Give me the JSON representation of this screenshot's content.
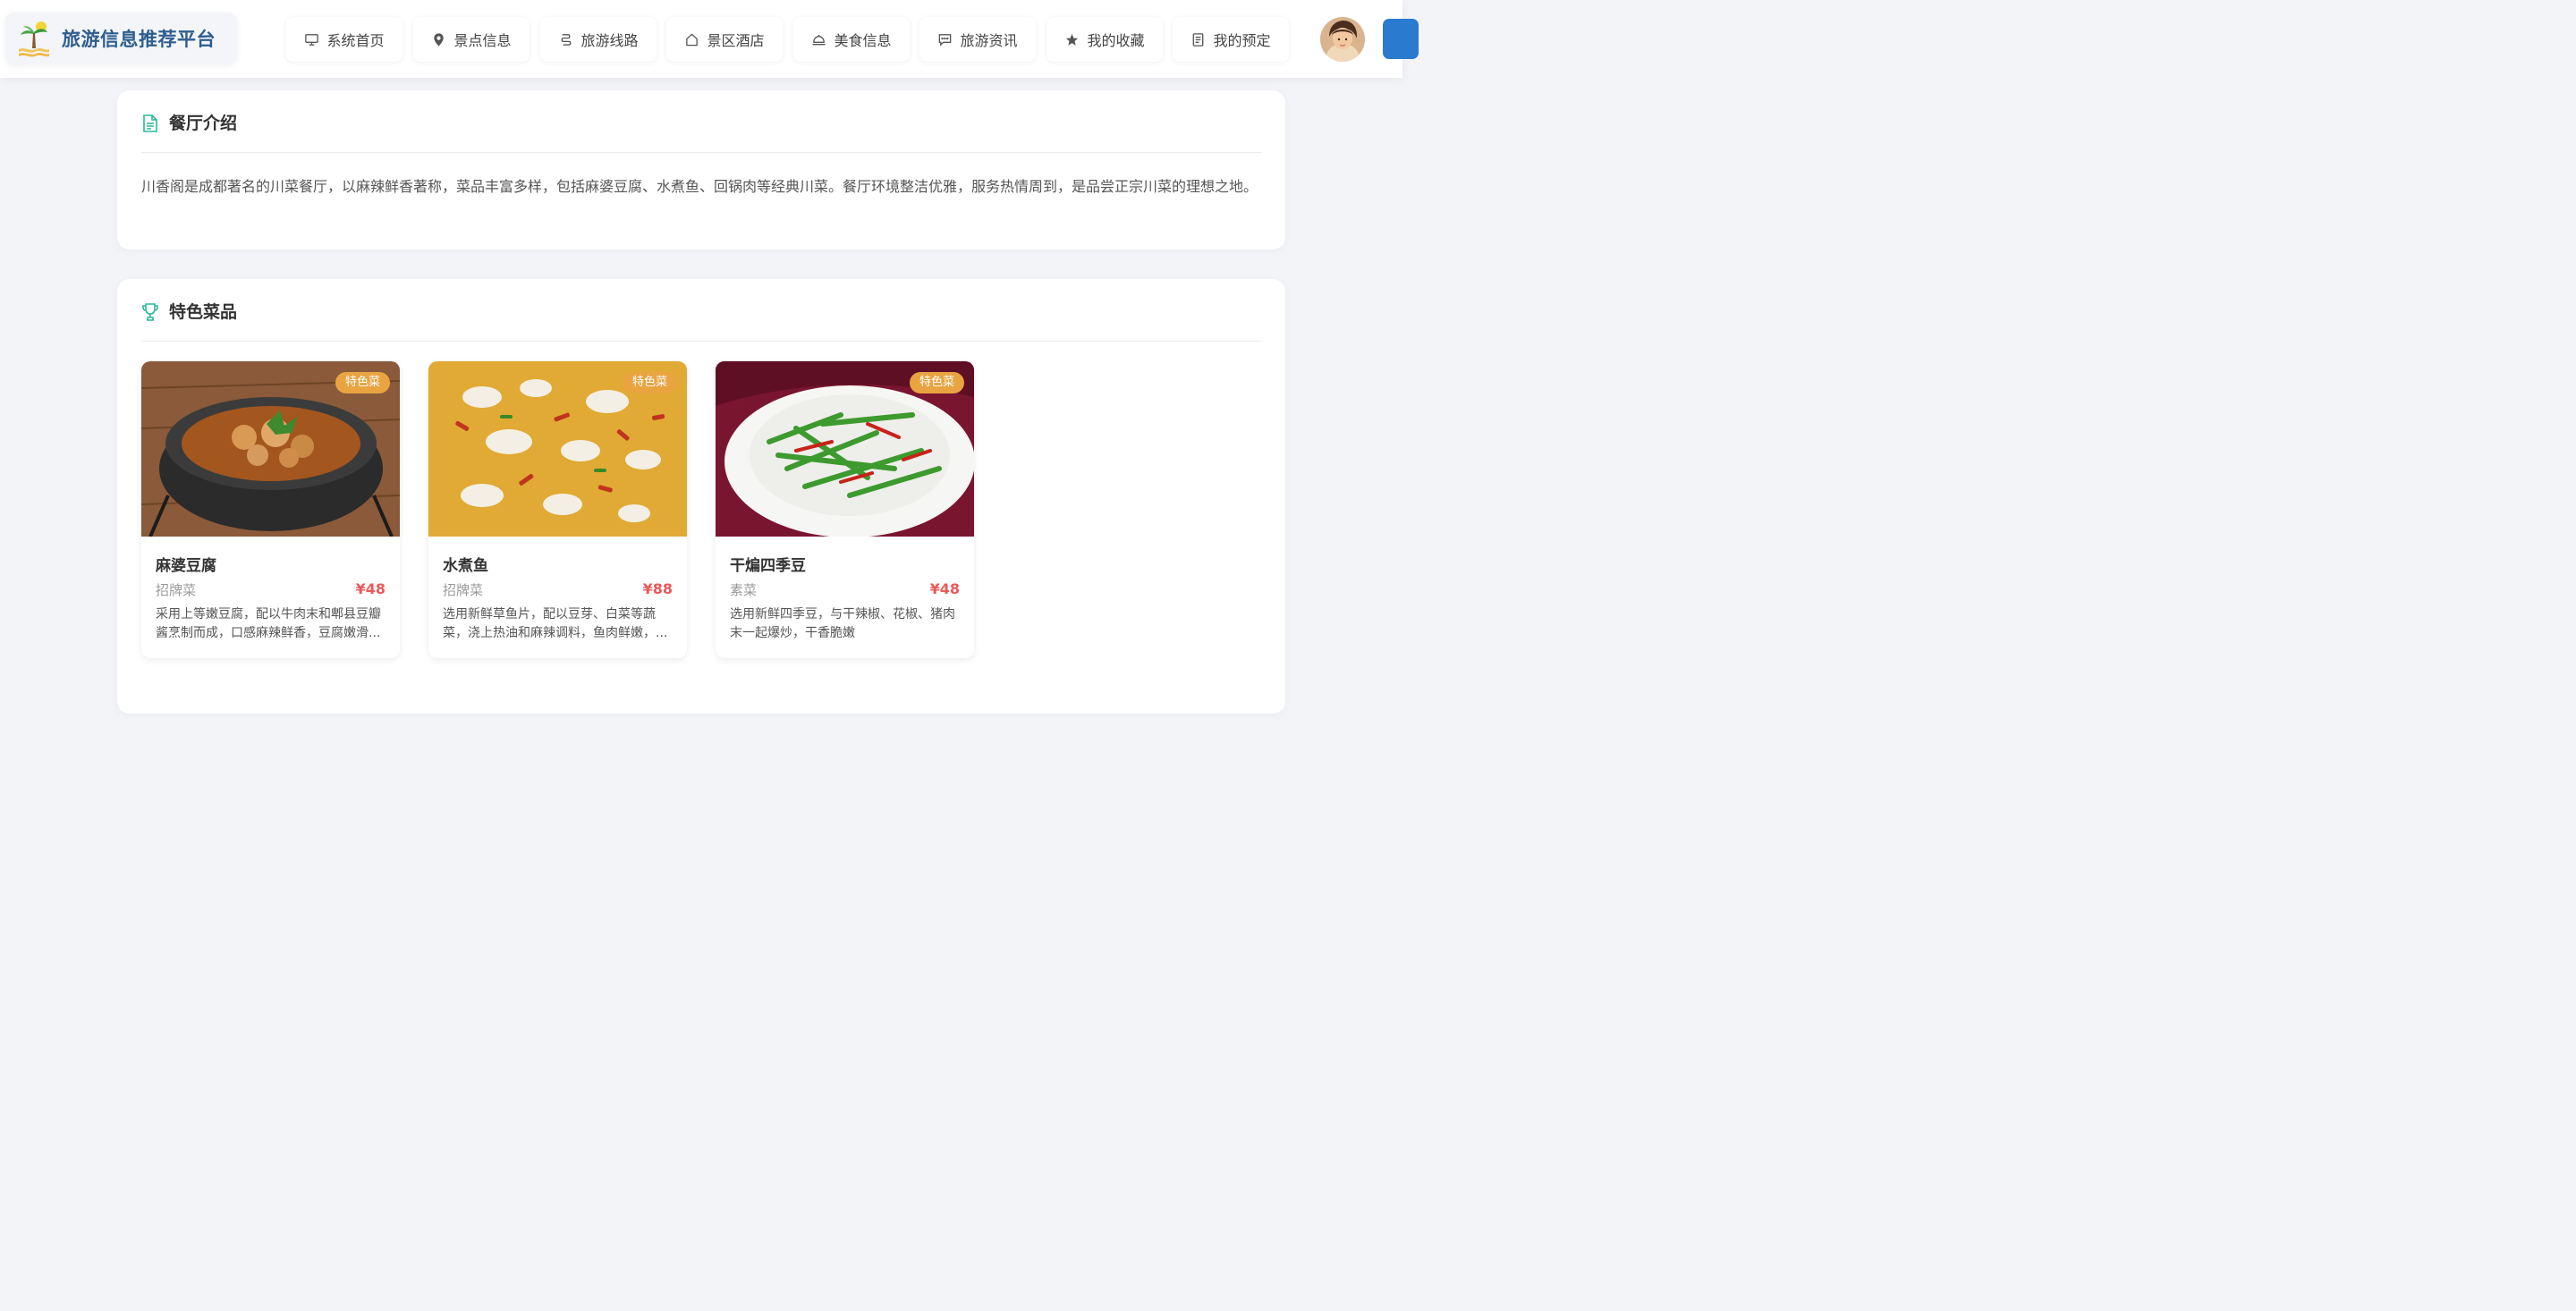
{
  "header": {
    "brand_title": "旅游信息推荐平台",
    "nav": [
      {
        "label": "系统首页",
        "icon": "monitor-icon"
      },
      {
        "label": "景点信息",
        "icon": "map-pin-icon"
      },
      {
        "label": "旅游线路",
        "icon": "route-icon"
      },
      {
        "label": "景区酒店",
        "icon": "home-icon"
      },
      {
        "label": "美食信息",
        "icon": "dish-cover-icon"
      },
      {
        "label": "旅游资讯",
        "icon": "chat-icon"
      },
      {
        "label": "我的收藏",
        "icon": "star-icon"
      },
      {
        "label": "我的预定",
        "icon": "document-icon"
      }
    ]
  },
  "intro": {
    "title": "餐厅介绍",
    "text": "川香阁是成都著名的川菜餐厅，以麻辣鲜香著称，菜品丰富多样，包括麻婆豆腐、水煮鱼、回锅肉等经典川菜。餐厅环境整洁优雅，服务热情周到，是品尝正宗川菜的理想之地。"
  },
  "featured": {
    "title": "特色菜品",
    "dishes": [
      {
        "badge": "特色菜",
        "name": "麻婆豆腐",
        "category": "招牌菜",
        "price": "¥48",
        "description": "采用上等嫩豆腐，配以牛肉末和郫县豆瓣酱烹制而成，口感麻辣鲜香，豆腐嫩滑..."
      },
      {
        "badge": "特色菜",
        "name": "水煮鱼",
        "category": "招牌菜",
        "price": "¥88",
        "description": "选用新鲜草鱼片，配以豆芽、白菜等蔬菜，浇上热油和麻辣调料，鱼肉鲜嫩，..."
      },
      {
        "badge": "特色菜",
        "name": "干煸四季豆",
        "category": "素菜",
        "price": "¥48",
        "description": "选用新鲜四季豆，与干辣椒、花椒、猪肉末一起爆炒，干香脆嫩"
      }
    ]
  },
  "colors": {
    "brand_title": "#2e5d8f",
    "accent_teal": "#2bb89a",
    "badge": "#e9a441",
    "price": "#e85a5a",
    "edge_button": "#2a7ad0"
  }
}
